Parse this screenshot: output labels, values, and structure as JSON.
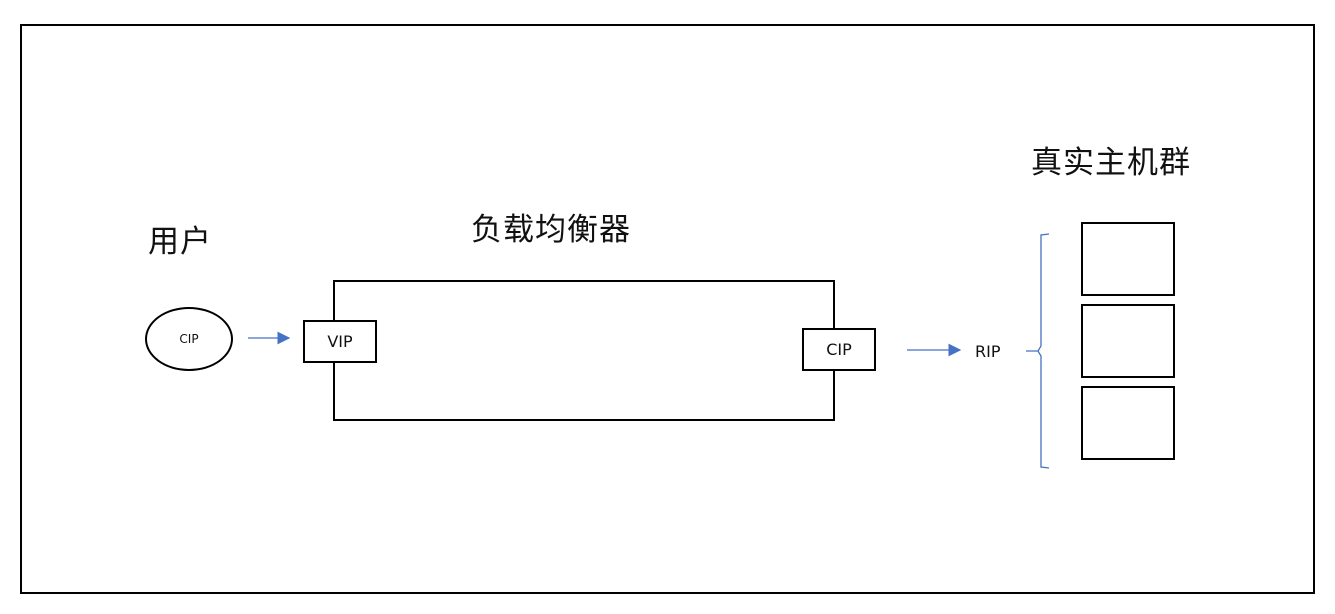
{
  "diagram": {
    "user": {
      "title": "用户",
      "node_label": "CIP"
    },
    "load_balancer": {
      "title": "负载均衡器",
      "ingress_label": "VIP",
      "egress_label": "CIP"
    },
    "real_servers": {
      "title": "真实主机群",
      "ip_label": "RIP",
      "server_count": 3
    },
    "colors": {
      "arrow": "#4472C4",
      "bracket": "#4472C4",
      "stroke": "#000000"
    }
  }
}
